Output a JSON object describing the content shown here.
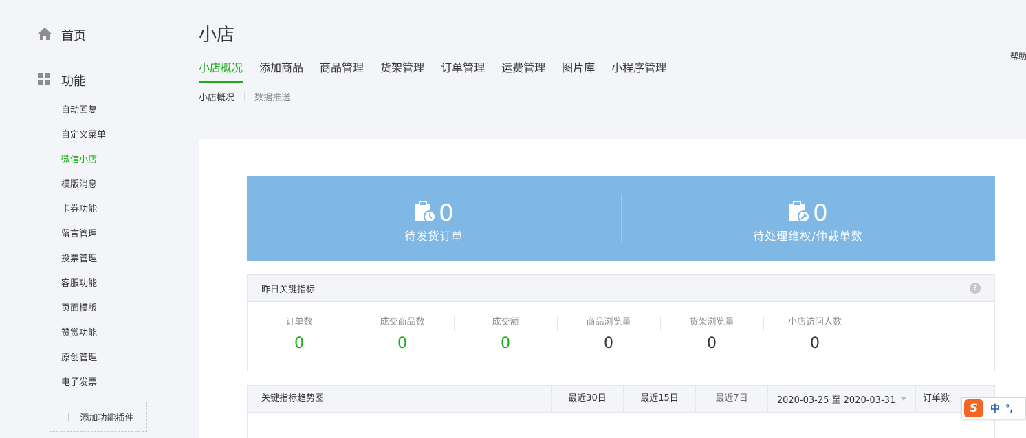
{
  "sidebar": {
    "home_label": "首页",
    "group_label": "功能",
    "items": [
      {
        "label": "自动回复"
      },
      {
        "label": "自定义菜单"
      },
      {
        "label": "微信小店",
        "active": true
      },
      {
        "label": "模版消息"
      },
      {
        "label": "卡券功能"
      },
      {
        "label": "留言管理"
      },
      {
        "label": "投票管理"
      },
      {
        "label": "客服功能"
      },
      {
        "label": "页面模版"
      },
      {
        "label": "赞赏功能"
      },
      {
        "label": "原创管理"
      },
      {
        "label": "电子发票"
      }
    ],
    "add_plugin_label": "添加功能插件"
  },
  "header": {
    "title": "小店",
    "help_label": "帮助",
    "tabs": [
      {
        "label": "小店概况",
        "active": true
      },
      {
        "label": "添加商品"
      },
      {
        "label": "商品管理"
      },
      {
        "label": "货架管理"
      },
      {
        "label": "订单管理"
      },
      {
        "label": "运费管理"
      },
      {
        "label": "图片库"
      },
      {
        "label": "小程序管理"
      }
    ],
    "subtabs": [
      {
        "label": "小店概况",
        "active": true
      },
      {
        "label": "数据推送"
      }
    ]
  },
  "banner": {
    "pending_shipment": {
      "value": "0",
      "label": "待发货订单"
    },
    "pending_disputes": {
      "value": "0",
      "label": "待处理维权/仲裁单数"
    }
  },
  "metrics": {
    "title": "昨日关键指标",
    "help_icon": "?",
    "items": [
      {
        "label": "订单数",
        "value": "0",
        "color": "#1aad19"
      },
      {
        "label": "成交商品数",
        "value": "0",
        "color": "#1aad19"
      },
      {
        "label": "成交额",
        "value": "0",
        "color": "#1aad19"
      },
      {
        "label": "商品浏览量",
        "value": "0"
      },
      {
        "label": "货架浏览量",
        "value": "0"
      },
      {
        "label": "小店访问人数",
        "value": "0"
      }
    ]
  },
  "trend": {
    "title": "关键指标趋势图",
    "ranges": [
      "最近30日",
      "最近15日",
      "最近7日"
    ],
    "date_range": "2020-03-25 至 2020-03-31",
    "metric_select": "订单数"
  },
  "ime": {
    "logo": "S",
    "lang": "中",
    "punct": "°,"
  },
  "colors": {
    "accent": "#1aad19",
    "banner": "#7fb8e5"
  }
}
